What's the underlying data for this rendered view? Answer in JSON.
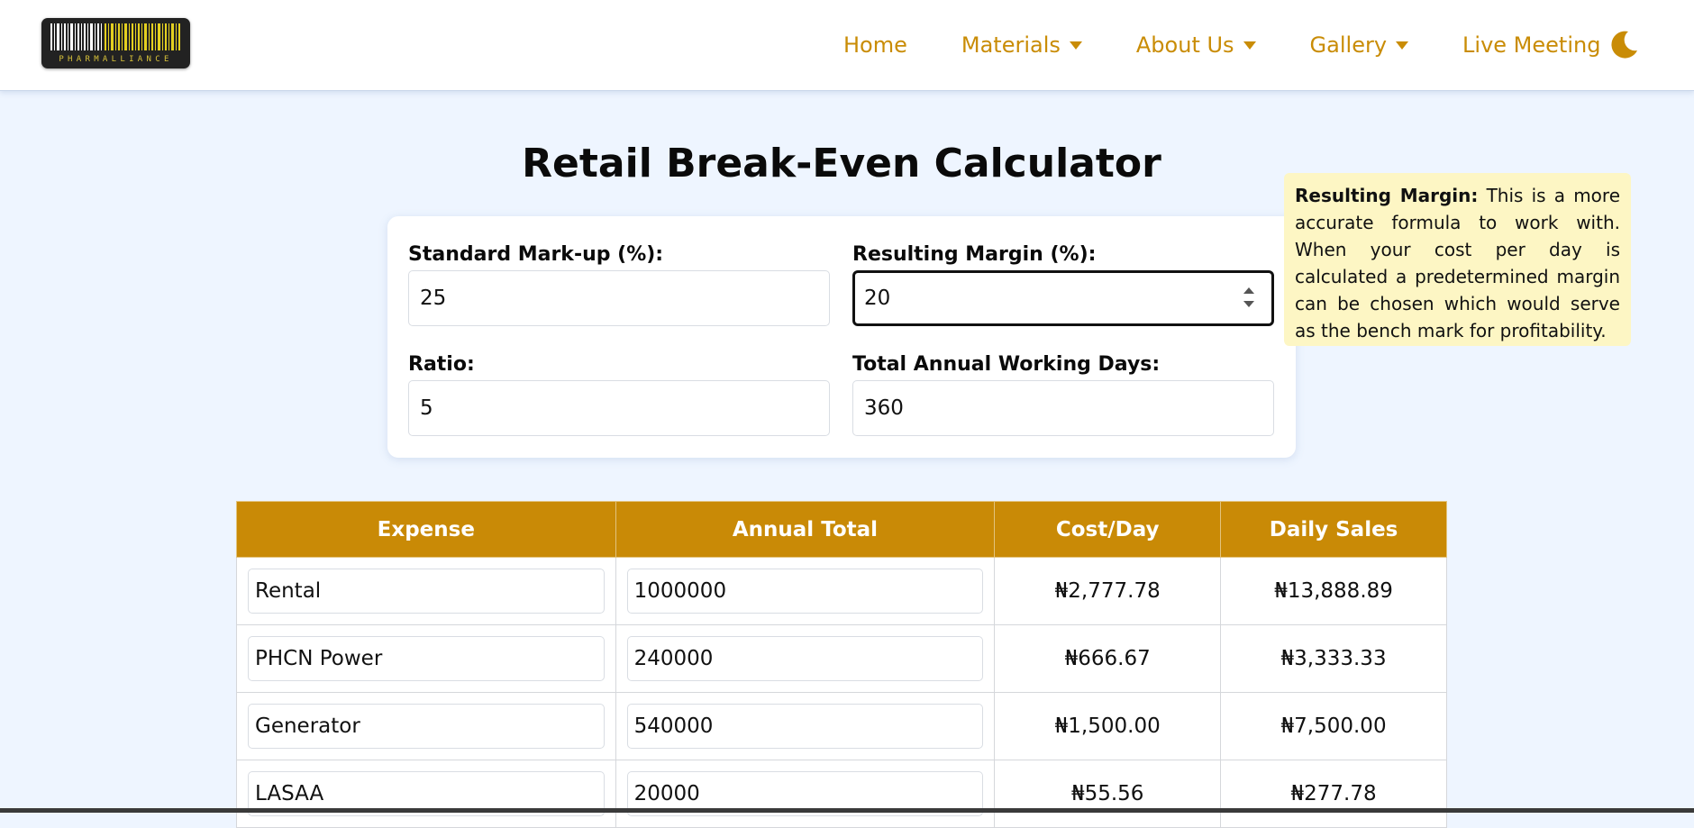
{
  "colors": {
    "accent": "#c98a06",
    "page_bg": "#eef5ff",
    "tooltip_bg": "#fdf6c4"
  },
  "logo": {
    "text": "PHARMALLIANCE"
  },
  "nav": {
    "items": [
      {
        "label": "Home",
        "has_dropdown": false
      },
      {
        "label": "Materials",
        "has_dropdown": true
      },
      {
        "label": "About Us",
        "has_dropdown": true
      },
      {
        "label": "Gallery",
        "has_dropdown": true
      },
      {
        "label": "Live Meeting",
        "has_dropdown": false
      }
    ],
    "theme_toggle_icon": "moon-icon"
  },
  "page": {
    "title": "Retail Break-Even Calculator"
  },
  "form": {
    "markup_label": "Standard Mark-up (%):",
    "markup_value": "25",
    "margin_label": "Resulting Margin (%):",
    "margin_value": "20",
    "ratio_label": "Ratio:",
    "ratio_value": "5",
    "days_label": "Total Annual Working Days:",
    "days_value": "360"
  },
  "tooltip": {
    "title": "Resulting Margin:",
    "body": "This is a more accurate formula to work with. When your cost per day is calculated a predetermined margin can be chosen which would serve as the bench mark for profitability."
  },
  "table": {
    "headers": [
      "Expense",
      "Annual Total",
      "Cost/Day",
      "Daily Sales"
    ],
    "rows": [
      {
        "expense": "Rental",
        "annual": "1000000",
        "cost_day": "₦2,777.78",
        "daily_sales": "₦13,888.89"
      },
      {
        "expense": "PHCN Power",
        "annual": "240000",
        "cost_day": "₦666.67",
        "daily_sales": "₦3,333.33"
      },
      {
        "expense": "Generator",
        "annual": "540000",
        "cost_day": "₦1,500.00",
        "daily_sales": "₦7,500.00"
      },
      {
        "expense": "LASAA",
        "annual": "20000",
        "cost_day": "₦55.56",
        "daily_sales": "₦277.78"
      }
    ]
  }
}
